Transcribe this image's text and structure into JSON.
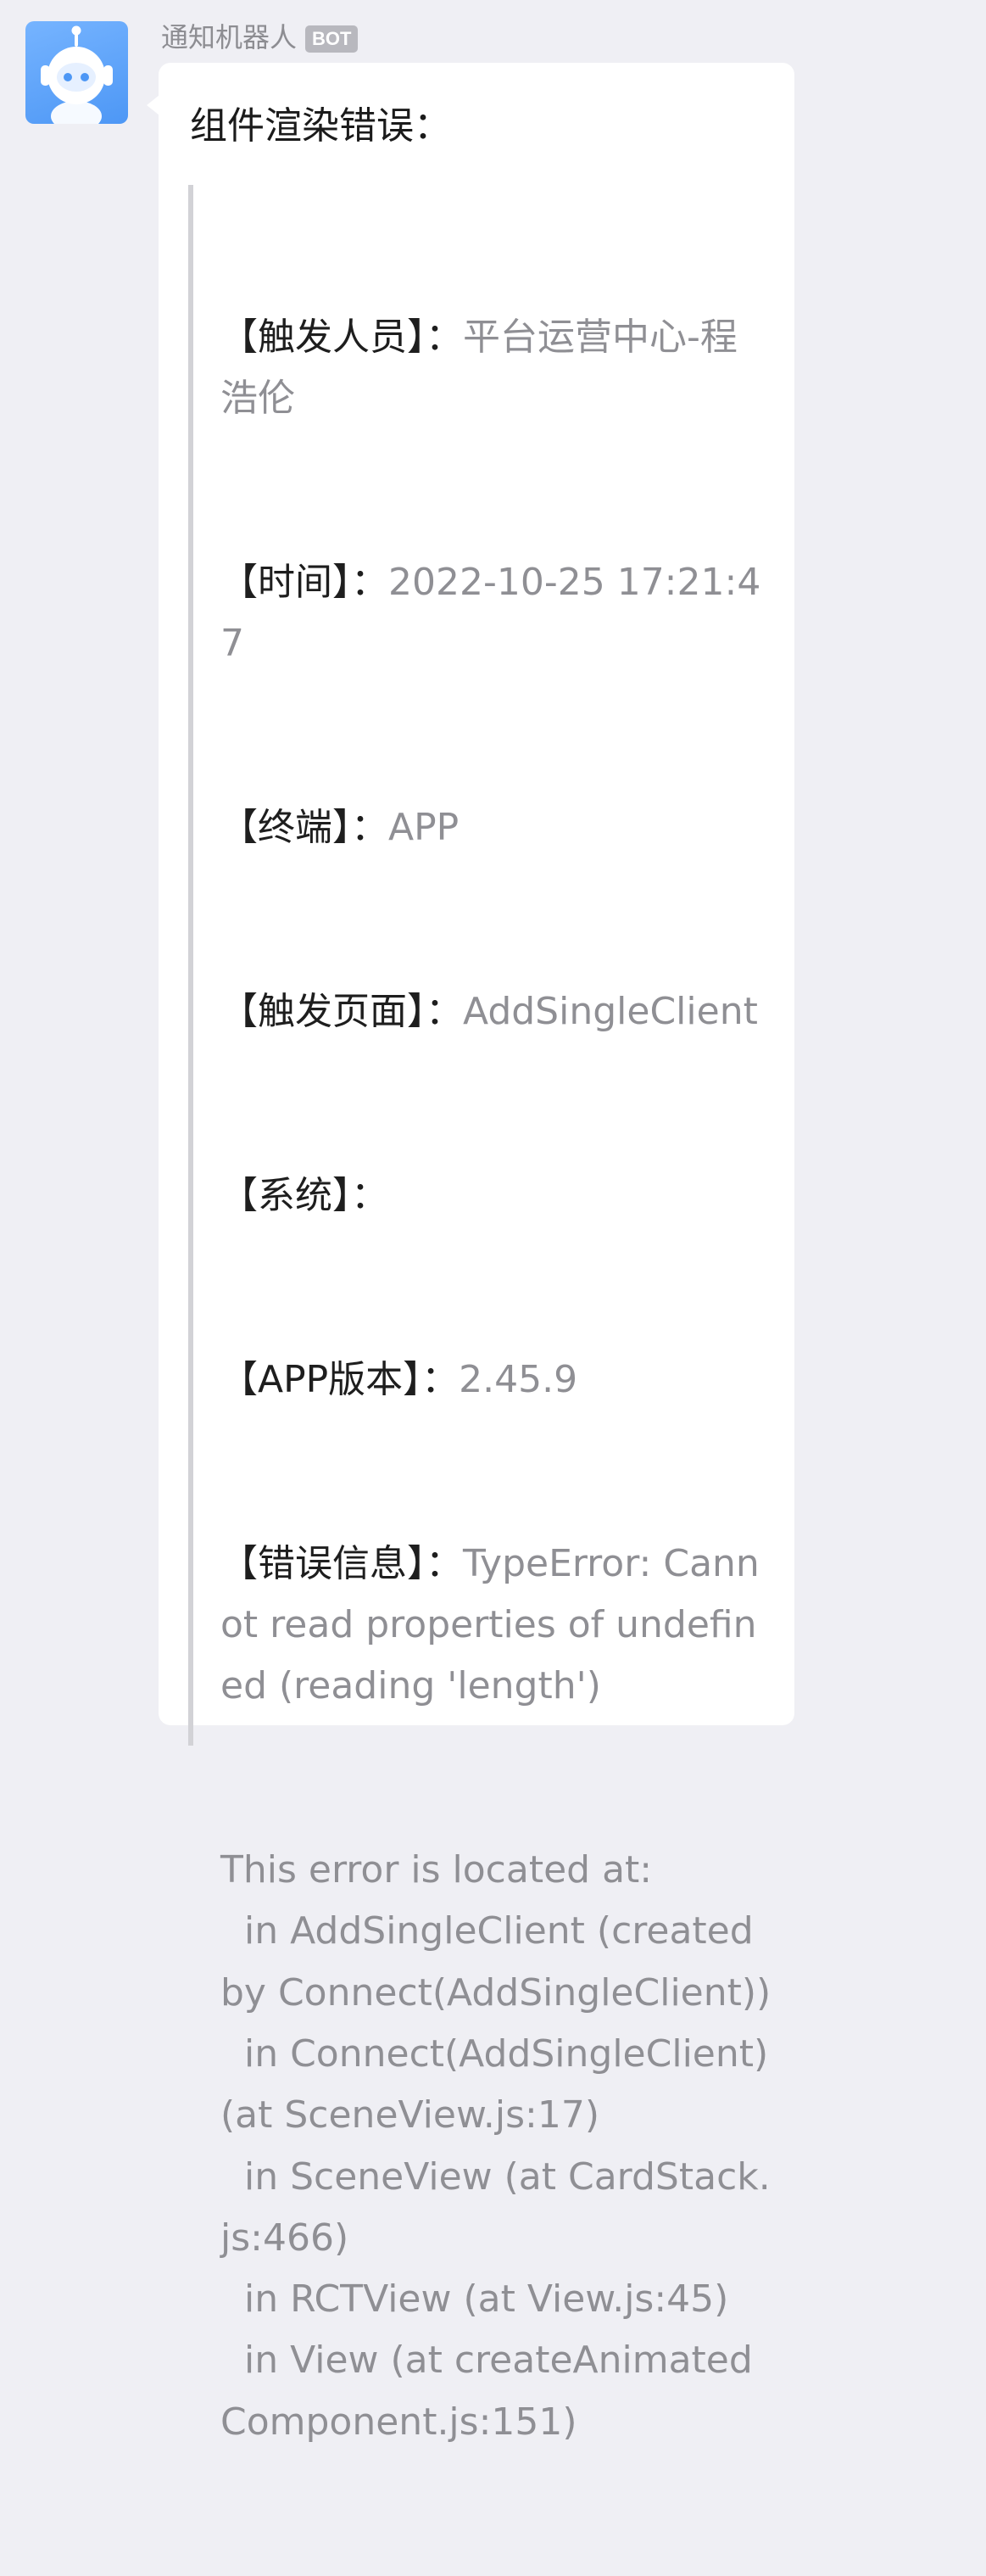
{
  "sender": {
    "name": "通知机器人",
    "badge": "BOT",
    "avatar_colors": {
      "background": "#5aa2f8",
      "face": "#ffffff",
      "eyes": "#4d97f5"
    }
  },
  "message": {
    "title": "组件渲染错误：",
    "fields": [
      {
        "key": "【触发人员】：",
        "value": "平台运营中心-程浩伦"
      },
      {
        "key": "【时间】：",
        "value": "2022-10-25 17:21:47"
      },
      {
        "key": "【终端】：",
        "value": "APP"
      },
      {
        "key": "【触发页面】：",
        "value": "AddSingleClient"
      },
      {
        "key": "【系统】：",
        "value": ""
      },
      {
        "key": "【APP版本】：",
        "value": "2.45.9"
      },
      {
        "key": "【错误信息】：",
        "value": "TypeError: Cannot read properties of undefined (reading 'length')"
      }
    ],
    "stack_trace": "This error is located at:\n  in AddSingleClient (created by Connect(AddSingleClient))\n  in Connect(AddSingleClient) (at SceneView.js:17)\n  in SceneView (at CardStack.js:466)\n  in RCTView (at View.js:45)\n  in View (at createAnimatedComponent.js:151)"
  },
  "colors": {
    "page_background": "#efeff4",
    "bubble_background": "#ffffff",
    "key_text": "#1e1e1e",
    "value_text": "#8f8f94",
    "quote_bar": "#d2d2d6"
  }
}
